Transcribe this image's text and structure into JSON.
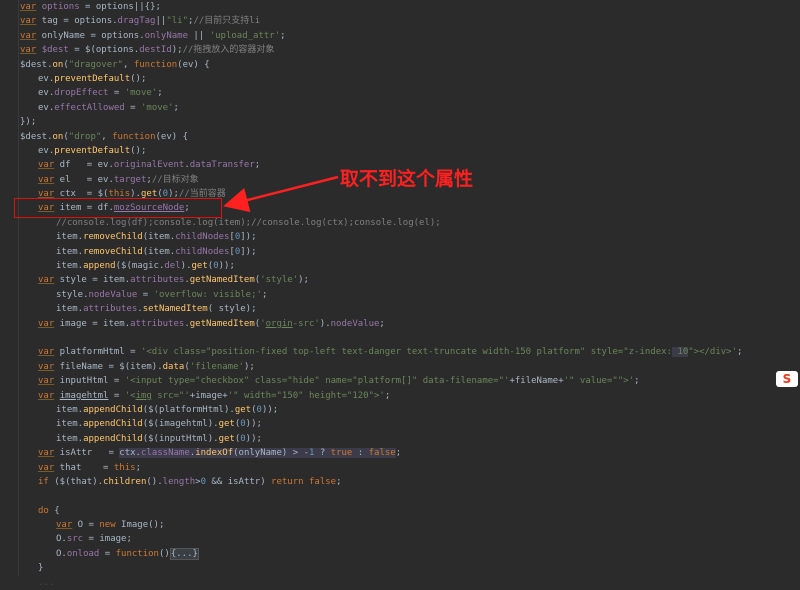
{
  "editor": {
    "lines": [
      {
        "indent": 0,
        "html": "<span class='k'>var</span> <span class='p'>options</span> = options||{};"
      },
      {
        "indent": 0,
        "html": "<span class='k'>var</span> tag = options.<span class='p'>dragTag</span>||<span class='s'>\"li\"</span>;<span class='c'>//目前只支持li</span>"
      },
      {
        "indent": 0,
        "html": "<span class='k'>var</span> onlyName = options.<span class='p'>onlyName</span> || <span class='s'>'upload_attr'</span>;"
      },
      {
        "indent": 0,
        "html": "<span class='k'>var</span> <span class='p'>$dest</span> = $(options.<span class='p'>destId</span>);<span class='c'>//拖拽放入的容器对象</span>"
      },
      {
        "indent": 0,
        "html": "$dest.<span class='f'>on</span>(<span class='s'>\"dragover\"</span>, <span class='kw'>function</span>(ev) {"
      },
      {
        "indent": 1,
        "html": "ev.<span class='f'>preventDefault</span>();"
      },
      {
        "indent": 1,
        "html": "ev.<span class='p'>dropEffect</span> = <span class='s'>'move'</span>;"
      },
      {
        "indent": 1,
        "html": "ev.<span class='p'>effectAllowed</span> = <span class='s'>'move'</span>;"
      },
      {
        "indent": 0,
        "html": "});"
      },
      {
        "indent": 0,
        "html": "$dest.<span class='f'>on</span>(<span class='s'>\"drop\"</span>, <span class='kw'>function</span>(ev) {"
      },
      {
        "indent": 1,
        "html": "ev.<span class='f'>preventDefault</span>();"
      },
      {
        "indent": 1,
        "html": "<span class='k'>var</span> df   = ev.<span class='p'>originalEvent</span>.<span class='p'>dataTransfer</span>;"
      },
      {
        "indent": 1,
        "html": "<span class='k'>var</span> el   = ev.<span class='p'>target</span>;<span class='c'>//目标对象</span>"
      },
      {
        "indent": 1,
        "html": "<span class='k'>var</span> ctx  = $(<span class='kw'>this</span>).<span class='f'>get</span>(<span class='n'>0</span>);<span class='c'>//当前容器</span>"
      },
      {
        "indent": 1,
        "html": "<span class='k'>var</span> item = df.<span class='p' style='text-decoration:underline'>mozSourceNode</span>;"
      },
      {
        "indent": 2,
        "html": "<span class='c'>//console.log(df);console.log(item);//console.log(ctx);console.log(el);</span>"
      },
      {
        "indent": 2,
        "html": "item.<span class='f'>removeChild</span>(item.<span class='p'>childNodes</span>[<span class='n'>0</span>]);"
      },
      {
        "indent": 2,
        "html": "item.<span class='f'>removeChild</span>(item.<span class='p'>childNodes</span>[<span class='n'>0</span>]);"
      },
      {
        "indent": 2,
        "html": "item.<span class='f'>append</span>($(magic.<span class='p'>del</span>).<span class='f'>get</span>(<span class='n'>0</span>));"
      },
      {
        "indent": 1,
        "html": "<span class='k'>var</span> style = item.<span class='p'>attributes</span>.<span class='f'>getNamedItem</span>(<span class='s'>'style'</span>);"
      },
      {
        "indent": 2,
        "html": "style.<span class='p'>nodeValue</span> = <span class='s'>'overflow: visible;'</span>;"
      },
      {
        "indent": 2,
        "html": "item.<span class='p'>attributes</span>.<span class='f'>setNamedItem</span>( style);"
      },
      {
        "indent": 1,
        "html": "<span class='k'>var</span> image = item.<span class='p'>attributes</span>.<span class='f'>getNamedItem</span>(<span class='s'>'<u>orgin</u>-src'</span>).<span class='p'>nodeValue</span>;"
      },
      {
        "indent": 0,
        "html": ""
      },
      {
        "indent": 1,
        "html": "<span class='k'>var</span> platformHtml = <span class='s'>'&lt;div class=\"position-fixed top-left text-danger text-truncate width-150 platform\" style=\"z-index:</span><span class='hl'><span class='s'> 10</span></span><span class='s'>\"&gt;&lt;/div&gt;'</span>;"
      },
      {
        "indent": 1,
        "html": "<span class='k'>var</span> fileName = $(item).<span class='f'>data</span>(<span class='s'>'filename'</span>);"
      },
      {
        "indent": 1,
        "html": "<span class='k'>var</span> inputHtml = <span class='s'>'&lt;input type=\"checkbox\" class=\"hide\" name=\"platform[]\" data-filename=\"'</span>+fileName+<span class='s'>'\" value=\"\"&gt;'</span>;"
      },
      {
        "indent": 1,
        "html": "<span class='k'>var</span> <span style='text-decoration:underline'>imagehtml</span> = <span class='s'>'&lt;<u>img</u> src=\"'</span>+image+<span class='s'>'\" width=\"150\" height=\"120\"&gt;'</span>;"
      },
      {
        "indent": 2,
        "html": "item.<span class='f'>appendChild</span>($(platformHtml).<span class='f'>get</span>(<span class='n'>0</span>));"
      },
      {
        "indent": 2,
        "html": "item.<span class='f'>appendChild</span>($(imagehtml).<span class='f'>get</span>(<span class='n'>0</span>));"
      },
      {
        "indent": 2,
        "html": "item.<span class='f'>appendChild</span>($(inputHtml).<span class='f'>get</span>(<span class='n'>0</span>));"
      },
      {
        "indent": 1,
        "html": "<span class='k'>var</span> isAttr   = <span class='hl'>ctx.<span class='p'>className</span>.<span class='f'>indexOf</span>(onlyName) &gt; -<span class='n'>1</span> ? <span class='kw'>true</span> : <span class='kw'>false</span></span>;"
      },
      {
        "indent": 1,
        "html": "<span class='k'>var</span> that    = <span class='kw'>this</span>;"
      },
      {
        "indent": 1,
        "html": "<span class='kw'>if</span> ($(that).<span class='f'>children</span>().<span class='p'>length</span>&gt;<span class='n'>0</span> &amp;&amp; isAttr) <span class='kw'>return false</span>;"
      },
      {
        "indent": 0,
        "html": ""
      },
      {
        "indent": 1,
        "html": "<span class='kw'>do</span> {"
      },
      {
        "indent": 2,
        "html": "<span class='k'>var</span> O = <span class='kw'>new</span> Image();"
      },
      {
        "indent": 2,
        "html": "O.<span class='p'>src</span> = image;"
      },
      {
        "indent": 2,
        "html": "O.<span class='p'>onload</span> = <span class='kw'>function</span>()<span class='fold'>{...}</span>"
      },
      {
        "indent": 1,
        "html": "}"
      },
      {
        "indent": 1,
        "html": "<span class='c' style='opacity:0.35'>...</span>"
      }
    ]
  },
  "annotation": {
    "text": "取不到这个属性",
    "color": "#ff2020"
  },
  "badge": {
    "text": "S"
  }
}
